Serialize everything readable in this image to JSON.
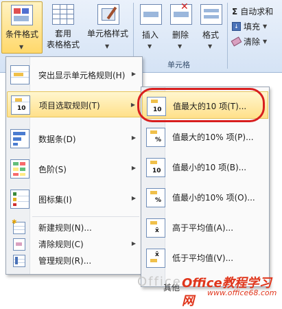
{
  "ribbon": {
    "conditional_format": "条件格式",
    "table_format_1": "套用",
    "table_format_2": "表格格式",
    "cell_style": "单元格样式",
    "insert": "插入",
    "delete": "删除",
    "format": "格式",
    "cells_group": "单元格",
    "autosum": "自动求和",
    "fill": "填充",
    "clear": "清除"
  },
  "menu": {
    "items": [
      {
        "label": "突出显示单元格规则(H)"
      },
      {
        "label": "项目选取规则(T)"
      },
      {
        "label": "数据条(D)"
      },
      {
        "label": "色阶(S)"
      },
      {
        "label": "图标集(I)"
      },
      {
        "label": "新建规则(N)..."
      },
      {
        "label": "清除规则(C)"
      },
      {
        "label": "管理规则(R)..."
      }
    ]
  },
  "submenu": {
    "items": [
      {
        "label": "值最大的10 项(T)...",
        "icon_text": "10"
      },
      {
        "label": "值最大的10% 项(P)...",
        "icon_text": "%"
      },
      {
        "label": "值最小的10 项(B)...",
        "icon_text": "10"
      },
      {
        "label": "值最小的10% 项(O)...",
        "icon_text": "%"
      },
      {
        "label": "高于平均值(A)...",
        "icon_text": "x̄"
      },
      {
        "label": "低于平均值(V)...",
        "icon_text": "x̄"
      }
    ],
    "partial_label": "其他"
  },
  "watermark": {
    "text": "Office",
    "brand": "Office教程学习网",
    "url": "www.office68.com"
  },
  "colors": {
    "highlight": "#ffe08a",
    "oval": "#d81e1e",
    "brand": "#e0361c"
  }
}
